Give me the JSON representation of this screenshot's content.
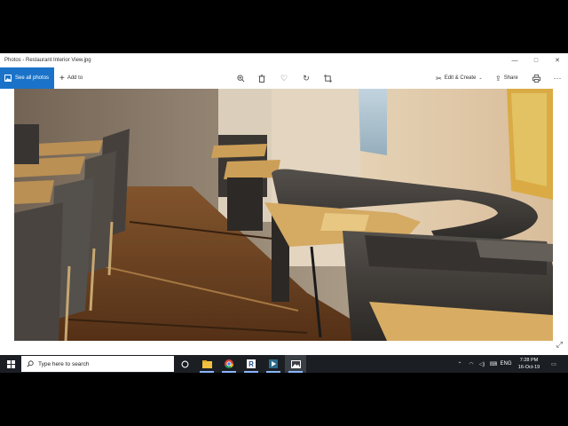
{
  "window": {
    "title": "Photos - Restaurant Interior View.jpg",
    "minimize_icon": "minimize-icon",
    "maximize_icon": "maximize-icon",
    "close_icon": "close-icon"
  },
  "toolbar": {
    "see_all_label": "See all photos",
    "add_to_label": "Add to",
    "zoom_icon": "zoom-in-icon",
    "delete_icon": "trash-icon",
    "favorite_icon": "heart-icon",
    "rotate_icon": "rotate-icon",
    "crop_icon": "crop-icon",
    "edit_label": "Edit & Create",
    "share_label": "Share",
    "print_icon": "print-icon",
    "more_icon": "more-icon"
  },
  "photo": {
    "subject": "restaurant-interior-photo"
  },
  "taskbar": {
    "search_placeholder": "Type here to search",
    "language": "ENG",
    "time": "7:28 PM",
    "date": "16-Oct-19",
    "apps": [
      "cortana-icon",
      "file-explorer-icon",
      "chrome-icon",
      "revit-icon",
      "media-app-icon",
      "photos-icon"
    ]
  },
  "colors": {
    "accent": "#1a73c8",
    "taskbar": "#1b1f24"
  }
}
